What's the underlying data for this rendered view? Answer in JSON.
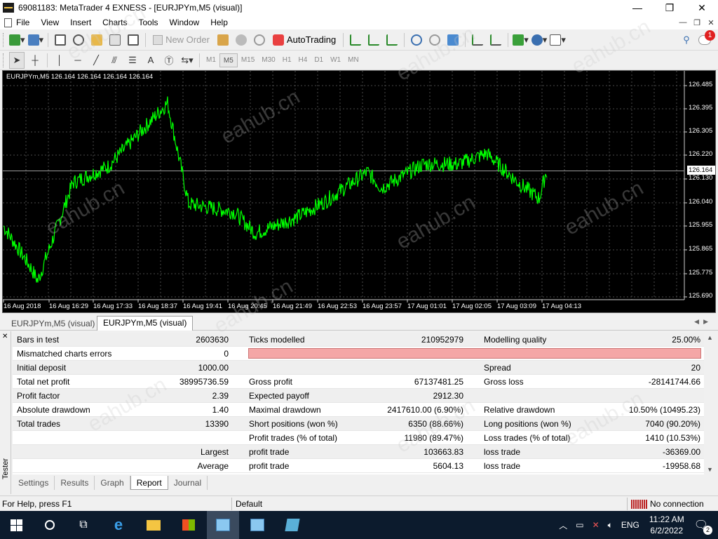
{
  "window": {
    "title": "69081183: MetaTrader 4 EXNESS - [EURJPYm,M5 (visual)]",
    "min_icon": "minimize-icon",
    "max_icon": "maximize-icon",
    "close_icon": "close-icon"
  },
  "menu": {
    "items": [
      "File",
      "View",
      "Insert",
      "Charts",
      "Tools",
      "Window",
      "Help"
    ]
  },
  "toolbar1": {
    "new_order": "New Order",
    "autotrading": "AutoTrading"
  },
  "toolbar2": {
    "text_tool": "A",
    "timeframes": [
      "M1",
      "M5",
      "M15",
      "M30",
      "H1",
      "H4",
      "D1",
      "W1",
      "MN"
    ],
    "active_timeframe": "M5"
  },
  "notifications": {
    "count": "1"
  },
  "chart": {
    "label": "EURJPYm,M5  126.164 126.164 126.164 126.164",
    "current_price": "126.164",
    "price_ticks": [
      "126.485",
      "126.395",
      "126.305",
      "126.220",
      "126.130",
      "126.040",
      "125.955",
      "125.865",
      "125.775",
      "125.690"
    ],
    "time_ticks": [
      "16 Aug 2018",
      "16 Aug 16:29",
      "16 Aug 17:33",
      "16 Aug 18:37",
      "16 Aug 19:41",
      "16 Aug 20:45",
      "16 Aug 21:49",
      "16 Aug 22:53",
      "16 Aug 23:57",
      "17 Aug 01:01",
      "17 Aug 02:05",
      "17 Aug 03:09",
      "17 Aug 04:13"
    ],
    "line_color": "#00ff00",
    "background": "#000000",
    "watermark": "eahub.cn"
  },
  "chart_data": {
    "type": "line",
    "title": "EURJPYm,M5",
    "xlabel": "",
    "ylabel": "",
    "ylim": [
      125.69,
      126.53
    ],
    "x": [
      "16 Aug 2018",
      "16 Aug 16:29",
      "16 Aug 17:33",
      "16 Aug 18:37",
      "16 Aug 19:41",
      "16 Aug 20:45",
      "16 Aug 21:49",
      "16 Aug 22:53",
      "16 Aug 23:57",
      "17 Aug 01:01",
      "17 Aug 02:05",
      "17 Aug 03:09",
      "17 Aug 04:13"
    ],
    "series": [
      {
        "values": [
          125.96,
          125.8,
          125.75,
          126.12,
          126.18,
          126.42,
          126.04,
          126.01,
          125.93,
          125.99,
          126.05,
          126.16,
          126.1,
          126.19,
          126.19,
          126.23,
          126.12,
          126.06,
          126.16
        ]
      }
    ],
    "grid": true
  },
  "chart_tabs": [
    "EURJPYm,M5 (visual)",
    "EURJPYm,M5 (visual)"
  ],
  "tester": {
    "side_label": "Tester",
    "rows": [
      {
        "c1l": "Bars in test",
        "c1v": "2603630",
        "c2l": "Ticks modelled",
        "c2v": "210952979",
        "c3l": "Modelling quality",
        "c3v": "25.00%"
      },
      {
        "c1l": "Mismatched charts errors",
        "c1v": "0",
        "c2l": "",
        "c2v": "",
        "c3l": "",
        "c3v": ""
      },
      {
        "c1l": "Initial deposit",
        "c1v": "1000.00",
        "c2l": "",
        "c2v": "",
        "c3l": "Spread",
        "c3v": "20"
      },
      {
        "c1l": "Total net profit",
        "c1v": "38995736.59",
        "c2l": "Gross profit",
        "c2v": "67137481.25",
        "c3l": "Gross loss",
        "c3v": "-28141744.66"
      },
      {
        "c1l": "Profit factor",
        "c1v": "2.39",
        "c2l": "Expected payoff",
        "c2v": "2912.30",
        "c3l": "",
        "c3v": ""
      },
      {
        "c1l": "Absolute drawdown",
        "c1v": "1.40",
        "c2l": "Maximal drawdown",
        "c2v": "2417610.00 (6.90%)",
        "c3l": "Relative drawdown",
        "c3v": "10.50% (10495.23)"
      },
      {
        "c1l": "Total trades",
        "c1v": "13390",
        "c2l": "Short positions (won %)",
        "c2v": "6350 (88.66%)",
        "c3l": "Long positions (won %)",
        "c3v": "7040 (90.20%)"
      },
      {
        "c1l": "",
        "c1v": "",
        "c2l": "Profit trades (% of total)",
        "c2v": "11980 (89.47%)",
        "c3l": "Loss trades (% of total)",
        "c3v": "1410 (10.53%)"
      },
      {
        "c1l": "",
        "c1v": "Largest",
        "c2l": "profit trade",
        "c2v": "103663.83",
        "c3l": "loss trade",
        "c3v": "-36369.00"
      },
      {
        "c1l": "",
        "c1v": "Average",
        "c2l": "profit trade",
        "c2v": "5604.13",
        "c3l": "loss trade",
        "c3v": "-19958.68"
      }
    ],
    "tabs": [
      "Settings",
      "Results",
      "Graph",
      "Report",
      "Journal"
    ],
    "active_tab": "Report"
  },
  "status": {
    "help": "For Help, press F1",
    "profile": "Default",
    "connection": "No connection"
  },
  "taskbar": {
    "time": "11:22 AM",
    "date": "6/2/2022",
    "lang": "ENG",
    "notif_count": "2"
  }
}
